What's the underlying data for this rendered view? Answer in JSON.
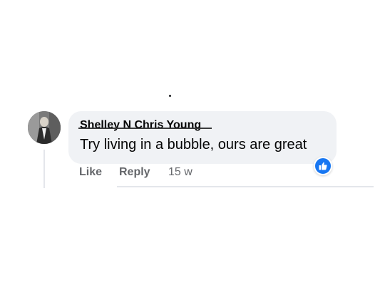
{
  "comment": {
    "author": "Shelley N Chris Young",
    "text": "Try living in a bubble, ours are great",
    "reaction": "like-icon"
  },
  "actions": {
    "like_label": "Like",
    "reply_label": "Reply",
    "timestamp": "15 w"
  },
  "colors": {
    "bubble_bg": "#f0f2f5",
    "action_text": "#65676b",
    "reaction_blue": "#1877f2"
  }
}
